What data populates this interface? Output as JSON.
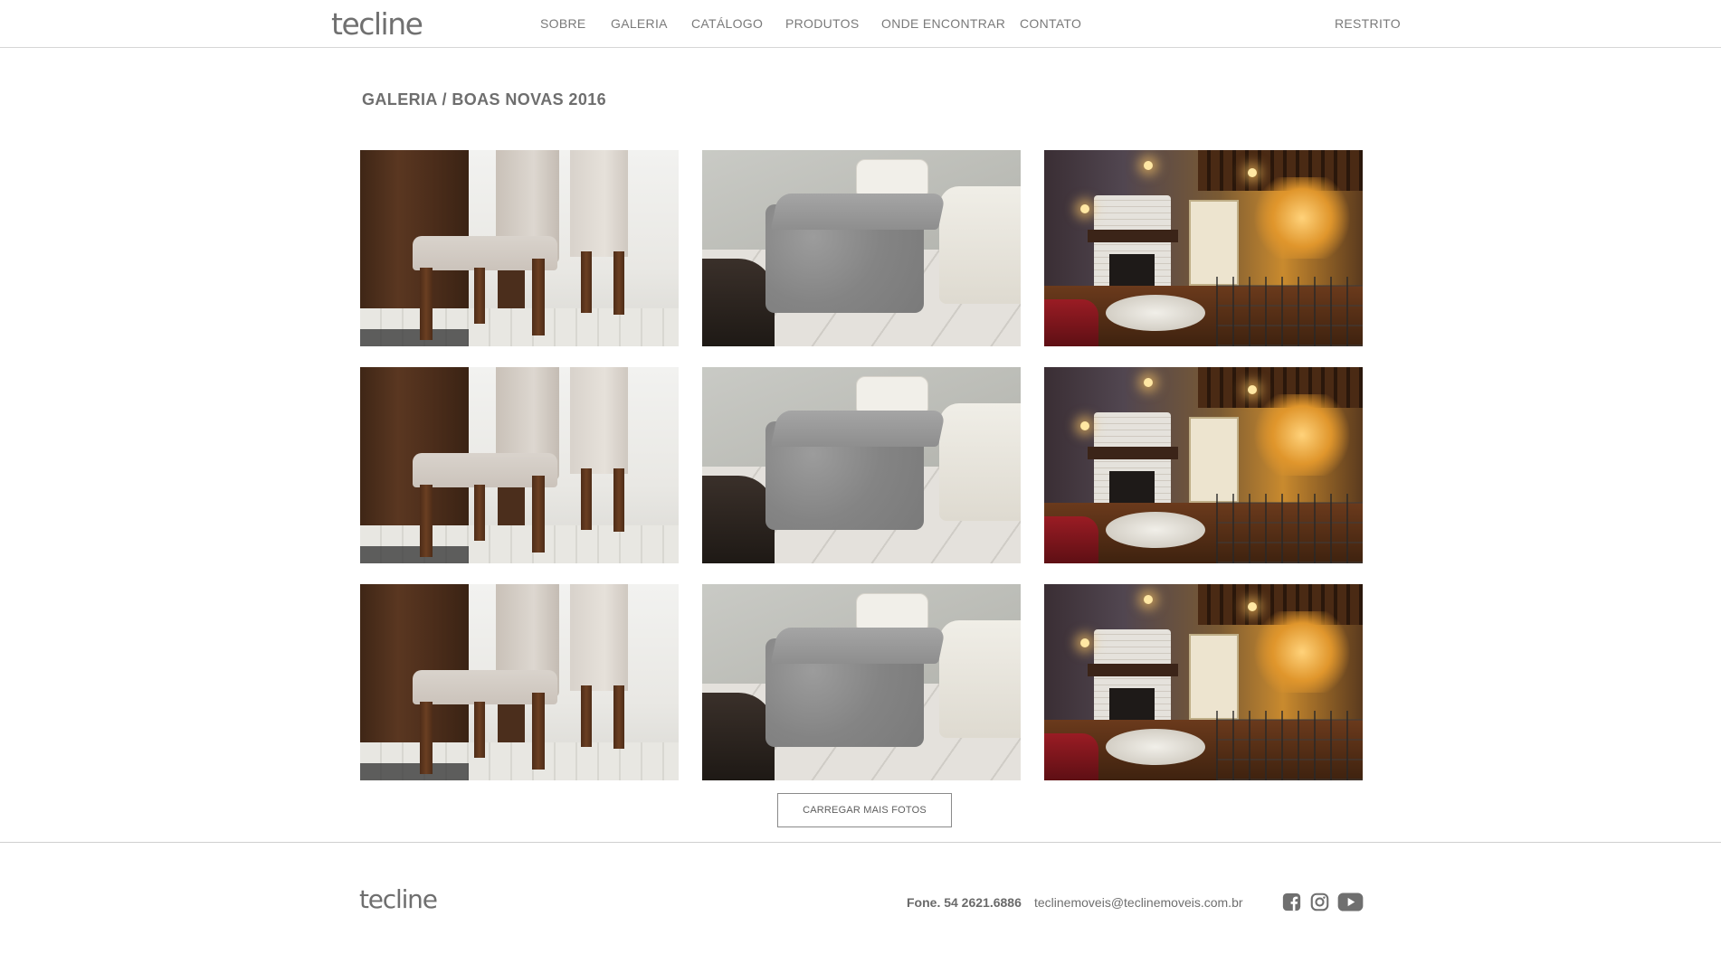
{
  "header": {
    "logo_text": "tecline",
    "nav": [
      {
        "label": "SOBRE"
      },
      {
        "label": "GALERIA"
      },
      {
        "label": "CATÁLOGO"
      },
      {
        "label": "PRODUTOS"
      },
      {
        "label": "ONDE ENCONTRAR"
      },
      {
        "label": "CONTATO"
      }
    ],
    "restricted_label": "RESTRITO"
  },
  "page": {
    "title": "GALERIA / BOAS NOVAS 2016"
  },
  "gallery": {
    "photos": [
      {
        "subject": "chairs"
      },
      {
        "subject": "pouf"
      },
      {
        "subject": "restaurant"
      },
      {
        "subject": "chairs"
      },
      {
        "subject": "pouf"
      },
      {
        "subject": "restaurant"
      },
      {
        "subject": "chairs"
      },
      {
        "subject": "pouf"
      },
      {
        "subject": "restaurant"
      }
    ],
    "load_more_label": "CARREGAR MAIS FOTOS"
  },
  "footer": {
    "logo_text": "tecline",
    "phone": "Fone. 54 2621.6886",
    "email": "teclinemoveis@teclinemoveis.com.br",
    "social": [
      {
        "icon": "facebook-icon"
      },
      {
        "icon": "instagram-icon"
      },
      {
        "icon": "youtube-icon"
      }
    ],
    "icon_color": "#6f6f6f"
  }
}
